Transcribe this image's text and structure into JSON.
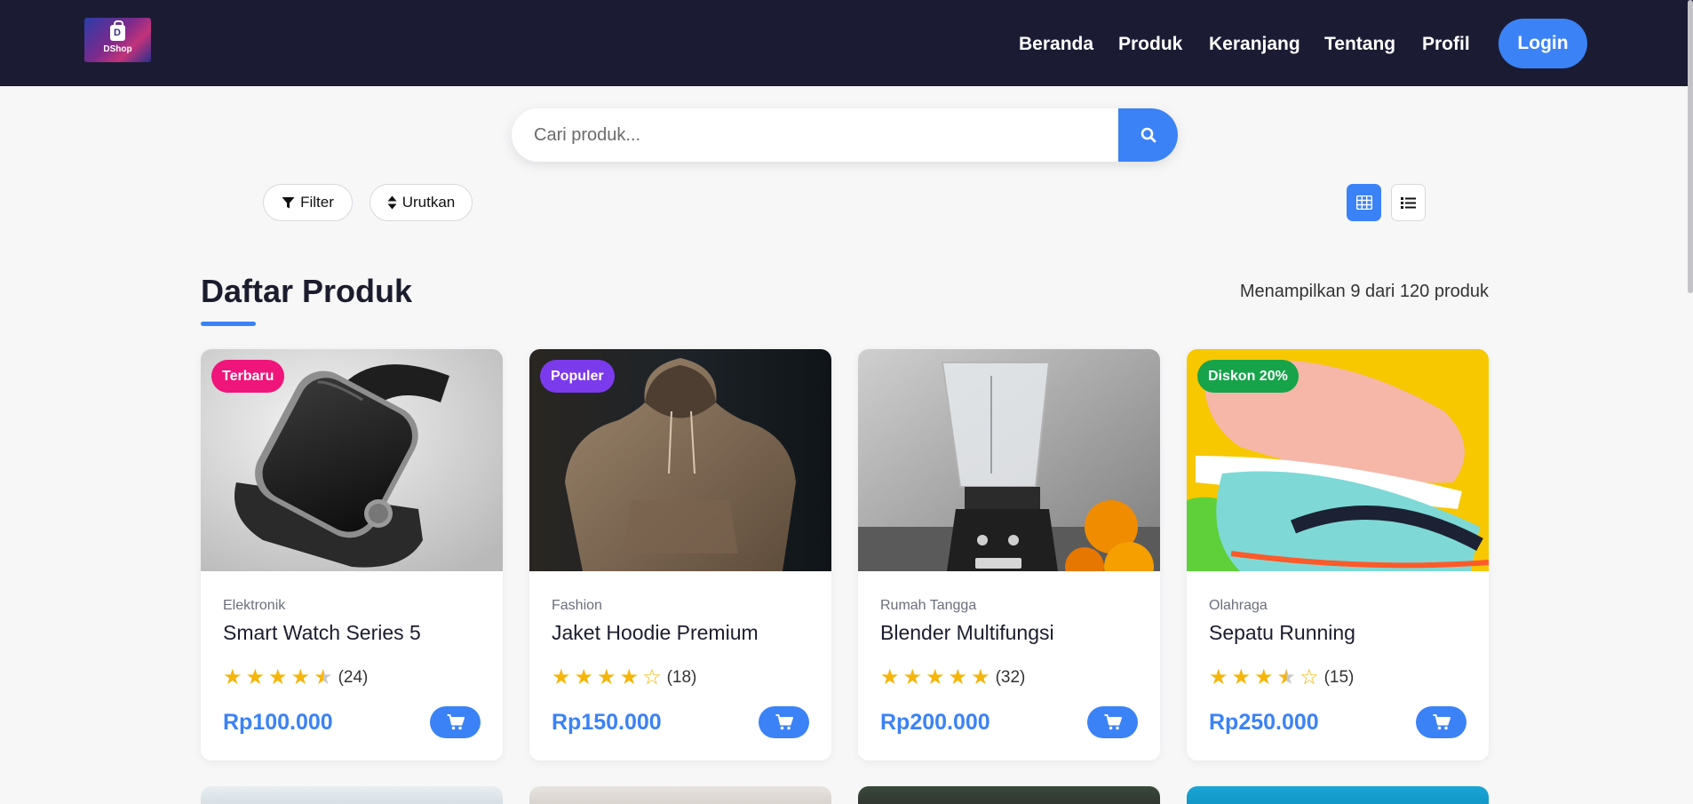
{
  "brand": {
    "logo_text": "DShop",
    "logo_letter": "D"
  },
  "nav": {
    "items": [
      "Beranda",
      "Produk",
      "Keranjang",
      "Tentang",
      "Profil"
    ],
    "login_label": "Login"
  },
  "search": {
    "placeholder": "Cari produk..."
  },
  "toolbar": {
    "filter_label": "Filter",
    "sort_label": "Urutkan",
    "view_mode": "grid"
  },
  "section": {
    "title": "Daftar Produk",
    "count_text": "Menampilkan 9 dari 120 produk"
  },
  "products": [
    {
      "badge": "Terbaru",
      "badge_color": "#f0157a",
      "category": "Elektronik",
      "name": "Smart Watch Series 5",
      "rating": 4.5,
      "reviews": "(24)",
      "price": "Rp100.000",
      "image": "smartwatch"
    },
    {
      "badge": "Populer",
      "badge_color": "#7c3aed",
      "category": "Fashion",
      "name": "Jaket Hoodie Premium",
      "rating": 4,
      "reviews": "(18)",
      "price": "Rp150.000",
      "image": "hoodie"
    },
    {
      "badge": "",
      "badge_color": "",
      "category": "Rumah Tangga",
      "name": "Blender Multifungsi",
      "rating": 5,
      "reviews": "(32)",
      "price": "Rp200.000",
      "image": "blender"
    },
    {
      "badge": "Diskon 20%",
      "badge_color": "#16a34a",
      "category": "Olahraga",
      "name": "Sepatu Running",
      "rating": 3.5,
      "reviews": "(15)",
      "price": "Rp250.000",
      "image": "running-shoes"
    }
  ],
  "colors": {
    "accent": "#3b82f6",
    "navbar": "#1b1c33",
    "star": "#f5b50a"
  }
}
